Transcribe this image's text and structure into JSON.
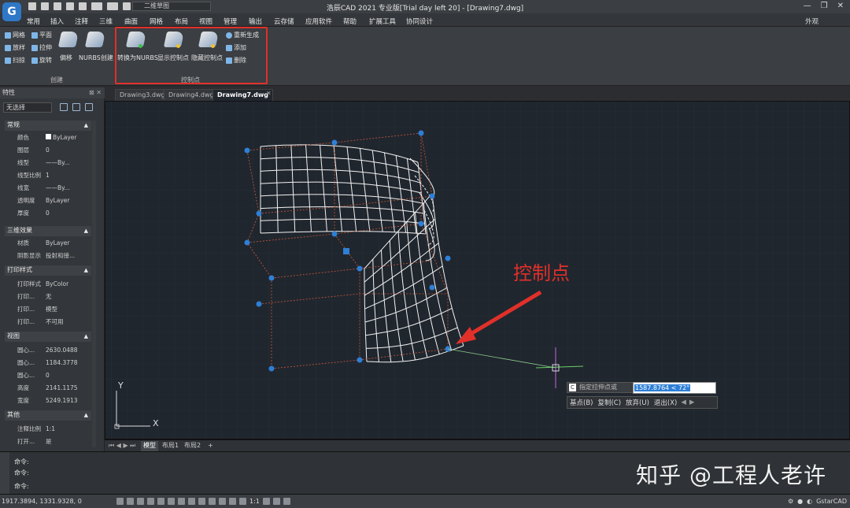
{
  "app": {
    "logo_letter": "G",
    "title": "浩辰CAD 2021 专业版[Trial day left 20] - [Drawing7.dwg]",
    "workspace": "二维草图"
  },
  "menu": [
    "常用",
    "插入",
    "注释",
    "三维",
    "曲面",
    "网格",
    "布局",
    "视图",
    "管理",
    "输出",
    "云存储",
    "应用软件",
    "帮助",
    "扩展工具",
    "协同设计"
  ],
  "appearance": "外观",
  "ribbon": {
    "create_group": {
      "label": "创建",
      "small": [
        "网格",
        "平面",
        "放样",
        "拉伸",
        "扫掠",
        "旋转"
      ],
      "big": [
        "偏移",
        "NURBS创建"
      ]
    },
    "cp_group": {
      "label": "控制点",
      "big": [
        "转换为NURBS",
        "显示控制点",
        "隐藏控制点"
      ],
      "small": [
        "重新生成",
        "添加",
        "删除"
      ]
    }
  },
  "tabs": [
    "Drawing3.dwg",
    "Drawing4.dwg",
    "Drawing7.dwg"
  ],
  "active_tab": "Drawing7.dwg",
  "properties": {
    "header": "特性",
    "selection": "无选择",
    "sections": [
      {
        "title": "常规",
        "rows": [
          [
            "颜色",
            "ByLayer"
          ],
          [
            "图层",
            "0"
          ],
          [
            "线型",
            "——By..."
          ],
          [
            "线型比例",
            "1"
          ],
          [
            "线宽",
            "——By..."
          ],
          [
            "透明度",
            "ByLayer"
          ],
          [
            "厚度",
            "0"
          ]
        ]
      },
      {
        "title": "三维效果",
        "rows": [
          [
            "材质",
            "ByLayer"
          ],
          [
            "阴影显示",
            "投射和接..."
          ]
        ]
      },
      {
        "title": "打印样式",
        "rows": [
          [
            "打印样式",
            "ByColor"
          ],
          [
            "打印...",
            "无"
          ],
          [
            "打印...",
            "模型"
          ],
          [
            "打印...",
            "不可用"
          ]
        ]
      },
      {
        "title": "视图",
        "rows": [
          [
            "圆心...",
            "2630.0488"
          ],
          [
            "圆心...",
            "1184.3778"
          ],
          [
            "圆心...",
            "0"
          ],
          [
            "高度",
            "2141.1175"
          ],
          [
            "宽度",
            "5249.1913"
          ]
        ]
      },
      {
        "title": "其他",
        "rows": [
          [
            "注释比例",
            "1:1"
          ],
          [
            "打开...",
            "是"
          ]
        ]
      }
    ]
  },
  "canvas": {
    "annotation": "控制点",
    "prompt_label": "指定拉伸点或",
    "prompt_value": "1587.8764 < 72°",
    "options": [
      "基点(B)",
      "复制(C)",
      "放弃(U)",
      "退出(X)"
    ],
    "axis_x": "X",
    "axis_y": "Y",
    "colors": {
      "annotation": "#e0302a",
      "control_point": "#2e7fd6",
      "wire": "#ffffff"
    }
  },
  "layout_tabs": [
    "模型",
    "布局1",
    "布局2"
  ],
  "command_lines": [
    "命令:",
    "命令:",
    "命令:"
  ],
  "status": {
    "coords": "1917.3894, 1331.9328, 0",
    "scale": "1:1",
    "brand": "GstarCAD"
  },
  "watermark": "知乎 @工程人老许"
}
